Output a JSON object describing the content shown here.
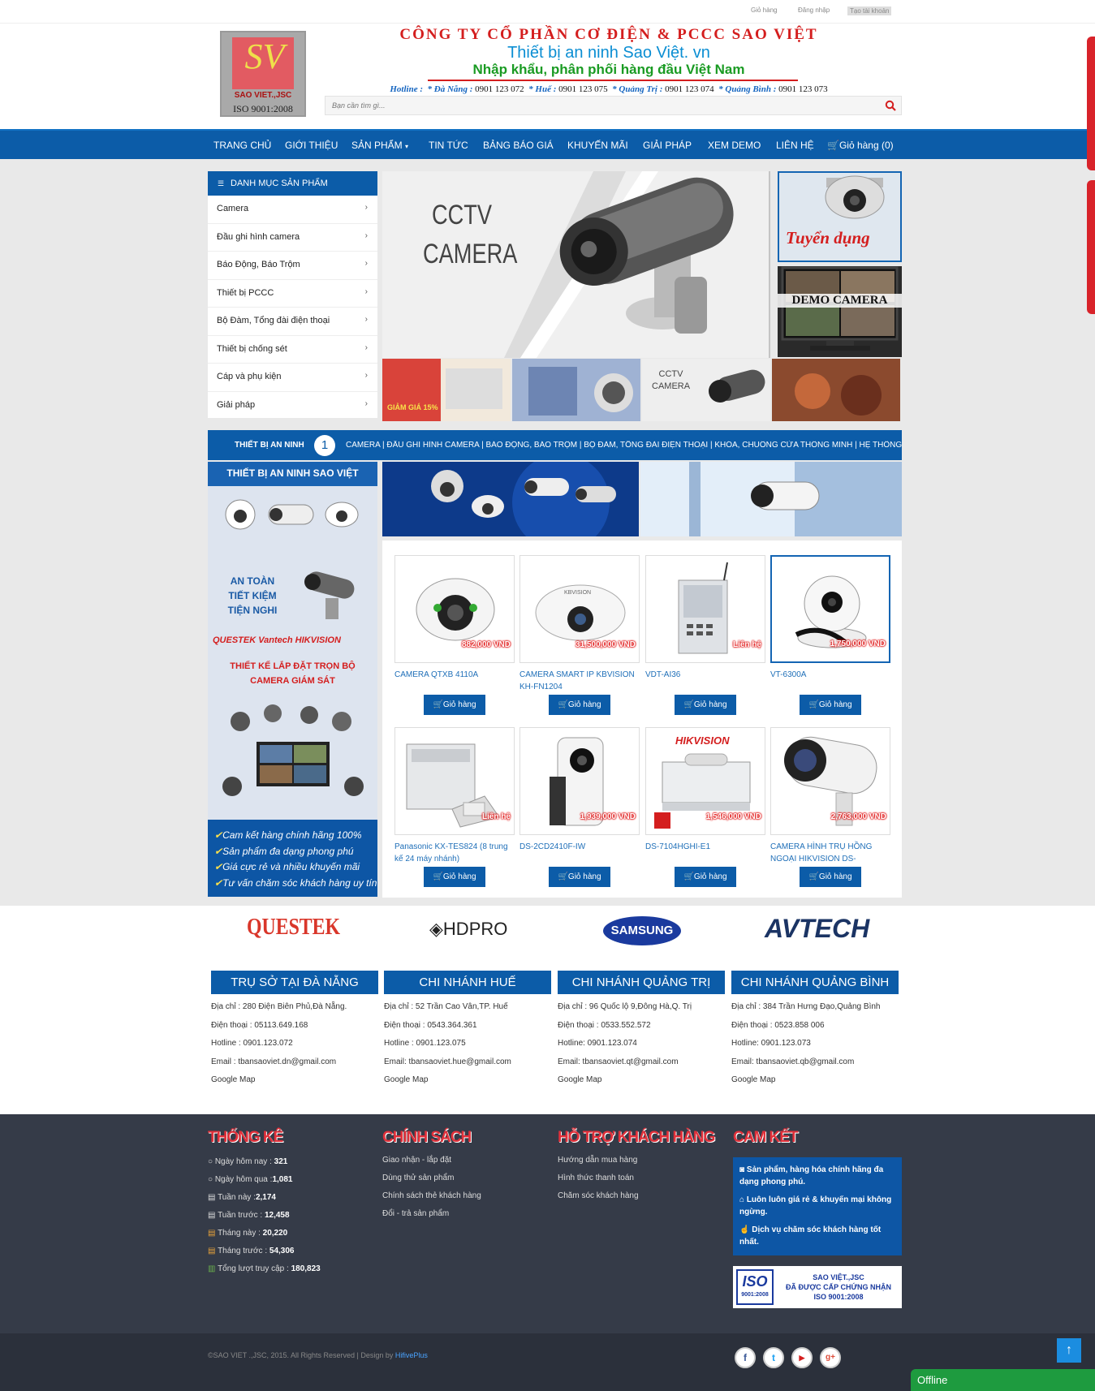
{
  "topbar": {
    "cart": "Giỏ hàng",
    "login": "Đăng nhập",
    "register": "Tạo tài khoản"
  },
  "logo": {
    "mark": "SV",
    "name": "SAO VIET.,JSC",
    "iso": "ISO 9001:2008"
  },
  "header": {
    "company": "CÔNG TY CỔ PHẦN CƠ ĐIỆN & PCCC SAO VIỆT",
    "tagline1": "Thiết bị an ninh Sao Việt. vn",
    "tagline2": "Nhập khẩu, phân phối hàng đầu Việt Nam",
    "hotline_label": "Hotline :",
    "hotlines": [
      {
        "city": "* Đà Nẵng :",
        "phone": "0901 123 072"
      },
      {
        "city": "* Huế :",
        "phone": "0901 123 075"
      },
      {
        "city": "* Quảng Trị :",
        "phone": "0901 123 074"
      },
      {
        "city": "* Quảng Bình :",
        "phone": "0901 123 073"
      }
    ]
  },
  "search": {
    "placeholder": "Bạn cần tìm gì..."
  },
  "nav": [
    "TRANG CHỦ",
    "GIỚI THIỆU",
    "SẢN PHẨM",
    "TIN TỨC",
    "BẢNG BÁO GIÁ",
    "KHUYẾN MÃI",
    "GIẢI PHÁP",
    "XEM DEMO",
    "LIÊN HỆ",
    "Giỏ hàng (0)"
  ],
  "categories": {
    "title": "DANH MỤC SẢN PHẨM",
    "items": [
      "Camera",
      "Đầu ghi hình camera",
      "Báo Động, Báo Trộm",
      "Thiết bị PCCC",
      "Bộ Đàm, Tổng đài điện thoại",
      "Thiết bị chống sét",
      "Cáp và phụ kiện",
      "Giải pháp"
    ]
  },
  "slider": {
    "line1": "CCTV",
    "line2": "CAMERA"
  },
  "side_ads": {
    "recruit": "Tuyển dụng",
    "demo": "DEMO CAMERA"
  },
  "thumbs": {
    "promo": "GIẢM GIÁ 15%",
    "cctv1": "CCTV",
    "cctv2": "CAMERA"
  },
  "security_bar": {
    "label": "THIẾT BỊ AN NINH",
    "number": "1",
    "links": "CAMERA | ĐẦU GHI HÌNH CAMERA | BÁO ĐỘNG, BÁO TRỘM | BỘ ĐÀM, TỔNG ĐÀI ĐIỆN THOẠI | KHÓA, CHUÔNG CỬA THÔNG MINH | HỆ THỐNG GIỮ XE THÔNG MINH"
  },
  "promo": {
    "title": "THIẾT BỊ AN NINH SAO VIỆT",
    "slogan": [
      "AN TOÀN",
      "TIẾT KIỆM",
      "TIỆN NGHI"
    ],
    "brands": "QUESTEK  Vantech  HIKVISION",
    "design1": "THIẾT KẾ LẮP ĐẶT TRỌN BỘ",
    "design2": "CAMERA GIÁM SÁT",
    "commitments": [
      "Cam kết hàng chính hãng 100%",
      "Sản phẩm đa dạng phong phú",
      "Giá cực rẻ và nhiều khuyến mãi",
      "Tư vấn chăm sóc khách hàng uy tín"
    ]
  },
  "products": [
    {
      "name": "CAMERA QTXB 4110A",
      "price": "882,000 VND",
      "cart": "Giỏ hàng"
    },
    {
      "name": "CAMERA SMART IP KBVISION KH-FN1204",
      "price": "31,500,000 VND",
      "cart": "Giỏ hàng",
      "brand": "KBVISION"
    },
    {
      "name": "VDT-AI36",
      "price": "Liên hệ",
      "cart": "Giỏ hàng"
    },
    {
      "name": "VT-6300A",
      "price": "1,750,000 VND",
      "cart": "Giỏ hàng"
    },
    {
      "name": "Panasonic KX-TES824 (8 trung kế 24 máy nhánh)",
      "price": "Liên hệ",
      "cart": "Giỏ hàng"
    },
    {
      "name": "DS-2CD2410F-IW",
      "price": "1,939,000 VND",
      "cart": "Giỏ hàng"
    },
    {
      "name": "DS-7104HGHI-E1",
      "price": "1,546,000 VND",
      "cart": "Giỏ hàng",
      "brand": "HIKVISION"
    },
    {
      "name": "CAMERA HÌNH TRỤ HỒNG NGOẠI HIKVISION DS-",
      "price": "2,763,000 VND",
      "cart": "Giỏ hàng"
    }
  ],
  "brands": [
    "QUESTEK",
    "HDPRO",
    "SAMSUNG",
    "AVTECH"
  ],
  "branches": [
    {
      "title": "TRỤ SỞ TẠI ĐÀ NẴNG",
      "lines": [
        "Địa chỉ : 280 Điện Biên Phủ,Đà Nẵng.",
        "Điện thoại : 05113.649.168",
        "Hotline : 0901.123.072",
        "Email : tbansaoviet.dn@gmail.com",
        "Google Map"
      ]
    },
    {
      "title": "CHI NHÁNH HUẾ",
      "lines": [
        "Địa chỉ : 52 Trần Cao Vân,TP. Huế",
        "Điện thoại : 0543.364.361",
        "Hotline : 0901.123.075",
        "Email: tbansaoviet.hue@gmail.com",
        "Google Map"
      ]
    },
    {
      "title": "CHI NHÁNH QUẢNG TRỊ",
      "lines": [
        "Địa chỉ : 96 Quốc lộ 9,Đông Hà,Q. Trị",
        "Điện thoại : 0533.552.572",
        "Hotline: 0901.123.074",
        "Email: tbansaoviet.qt@gmail.com",
        "Google Map"
      ]
    },
    {
      "title": "CHI NHÁNH QUẢNG BÌNH",
      "lines": [
        "Địa chỉ : 384 Trần Hưng Đạo,Quảng Bình",
        "Điện thoại : 0523.858 006",
        "Hotline: 0901.123.073",
        "Email: tbansaoviet.qb@gmail.com",
        "Google Map"
      ]
    }
  ],
  "footer": {
    "stats_title": "THỐNG KÊ",
    "stats": [
      {
        "label": "Ngày hôm nay :",
        "value": "321"
      },
      {
        "label": "Ngày hôm qua :",
        "value": "1,081"
      },
      {
        "label": "Tuần này :",
        "value": "2,174"
      },
      {
        "label": "Tuần trước :",
        "value": "12,458"
      },
      {
        "label": "Tháng này :",
        "value": "20,220"
      },
      {
        "label": "Tháng trước :",
        "value": "54,306"
      },
      {
        "label": "Tổng lượt truy cập :",
        "value": "180,823"
      }
    ],
    "policy_title": "CHÍNH SÁCH",
    "policy": [
      "Giao nhận - lắp đặt",
      "Dùng thử sản phẩm",
      "Chính sách thẻ khách hàng",
      "Đổi - trả sản phẩm"
    ],
    "support_title": "HỖ TRỢ KHÁCH HÀNG",
    "support": [
      "Hướng dẫn mua hàng",
      "Hình thức thanh toán",
      "Chăm sóc khách hàng"
    ],
    "commit_title": "CAM KẾT",
    "commit": [
      "Sản phẩm, hàng hóa chính hãng đa dạng phong phú.",
      "Luôn luôn giá rẻ & khuyến mại không ngừng.",
      "Dịch vụ chăm sóc khách hàng tốt nhất."
    ],
    "iso_logo": "ISO",
    "iso_logo_sub": "9001:2008",
    "iso_line1": "SAO VIỆT.,JSC",
    "iso_line2": "ĐÃ ĐƯỢC CẤP CHỨNG NHẬN",
    "iso_line3": "ISO 9001:2008",
    "copyright": "©SAO VIET .,JSC, 2015. All Rights Reserved | Design by",
    "designer": "HifivePlus",
    "social": [
      "f",
      "t",
      "▶",
      "g+"
    ],
    "offline": "Offline"
  }
}
